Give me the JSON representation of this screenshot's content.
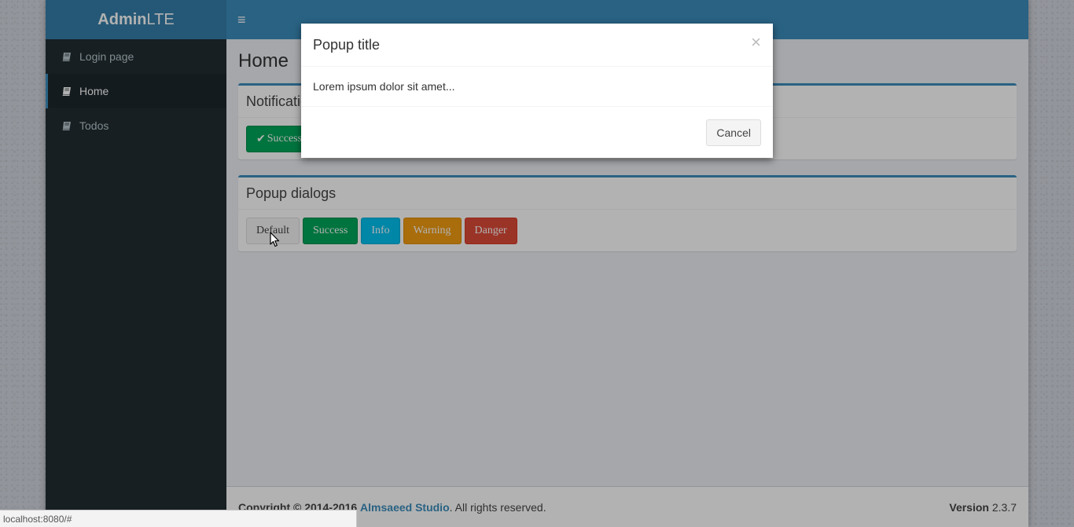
{
  "app": {
    "logo_bold": "Admin",
    "logo_light": "LTE"
  },
  "header": {
    "toggle_icon": "hamburger-icon"
  },
  "sidebar": {
    "items": [
      {
        "label": "Login page",
        "icon": "book-icon",
        "active": false
      },
      {
        "label": "Home",
        "icon": "book-icon",
        "active": true
      },
      {
        "label": "Todos",
        "icon": "book-icon",
        "active": false
      }
    ]
  },
  "main": {
    "page_title": "Home",
    "notifications": {
      "title": "Notifications",
      "buttons": [
        {
          "label": "Success",
          "icon": "check-icon"
        }
      ]
    },
    "popups": {
      "title": "Popup dialogs",
      "buttons": [
        {
          "label": "Default"
        },
        {
          "label": "Success"
        },
        {
          "label": "Info"
        },
        {
          "label": "Warning"
        },
        {
          "label": "Danger"
        }
      ]
    }
  },
  "footer": {
    "copyright": "Copyright © 2014-2016",
    "company": "Almsaeed Studio",
    "rights": ". All rights reserved.",
    "version_label": "Version",
    "version_value": "2.3.7"
  },
  "modal": {
    "title": "Popup title",
    "close": "×",
    "body": "Lorem ipsum dolor sit amet...",
    "cancel_label": "Cancel"
  },
  "statusbar": {
    "url": "localhost:8080/#"
  },
  "colors": {
    "primary": "#3c8dbc",
    "success": "#00a65a",
    "info": "#00c0ef",
    "warning": "#f39c12",
    "danger": "#dd4b39",
    "sidebar_bg": "#222d32"
  }
}
